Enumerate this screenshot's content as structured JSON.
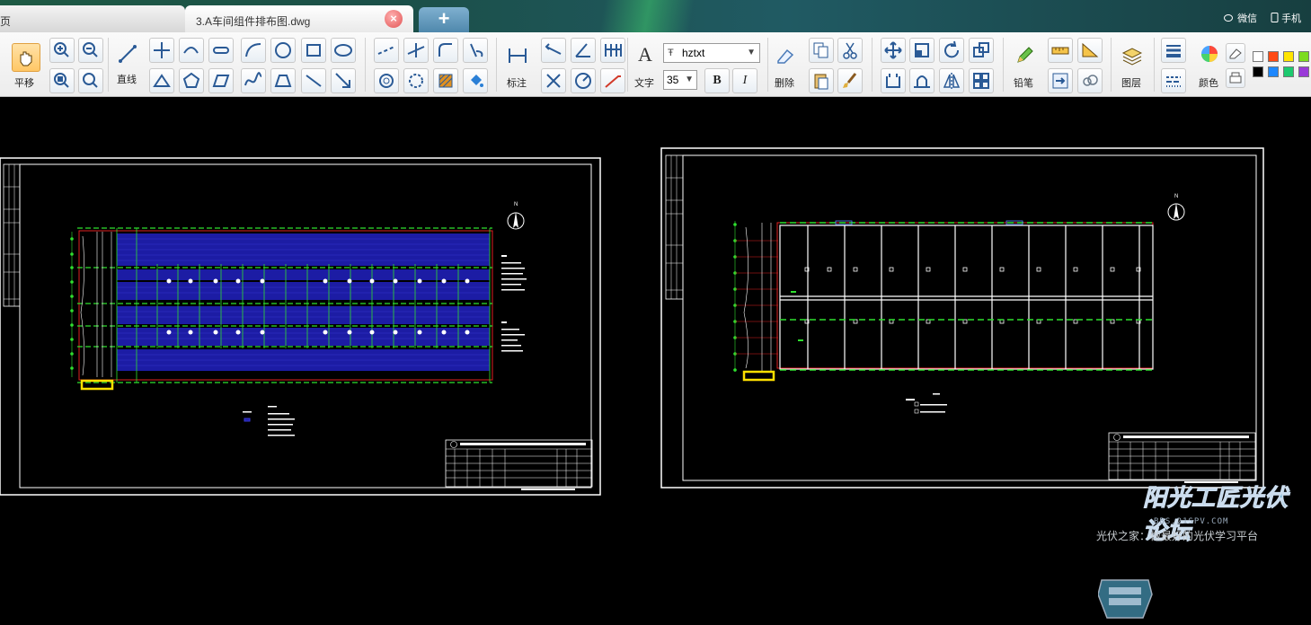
{
  "tabs": {
    "home_label": "页",
    "file_label": "3.A车间组件排布图.dwg",
    "close_glyph": "×",
    "add_glyph": "+"
  },
  "header_links": {
    "wechat": "微信",
    "phone": "手机"
  },
  "toolbar": {
    "pan_label": "平移",
    "line_label": "直线",
    "dimension_label": "标注",
    "text_label": "文字",
    "delete_label": "删除",
    "pencil_label": "铅笔",
    "layer_label": "图层",
    "color_label": "颜色",
    "font_name": "hztxt",
    "font_size": "35",
    "bold": "B",
    "italic": "I",
    "text_icon": "A",
    "swatches": [
      "#ffffff",
      "#ff4a14",
      "#ffe400",
      "#7ddc1f",
      "#000000",
      "#1e88ff",
      "#1ec96f",
      "#9a3ad8"
    ]
  },
  "icons": [
    "zoom-in-icon",
    "zoom-out-icon",
    "zoom-window-icon",
    "zoom-refresh-icon",
    "line-icon",
    "move-icon",
    "rotate-icon",
    "mirror-icon",
    "layer-icon",
    "pencil-icon"
  ],
  "colors": {
    "frame": "#ffffff",
    "panel_fill": "#1a1aa0",
    "grid_green": "#2fe02f",
    "outline_red": "#e02020",
    "highlight": "#ffe000"
  },
  "watermark": {
    "title": "阳光工匠光伏论坛",
    "url": "BBS.21SPV.COM",
    "slogan": "光伏之家：做最好的光伏学习平台"
  }
}
